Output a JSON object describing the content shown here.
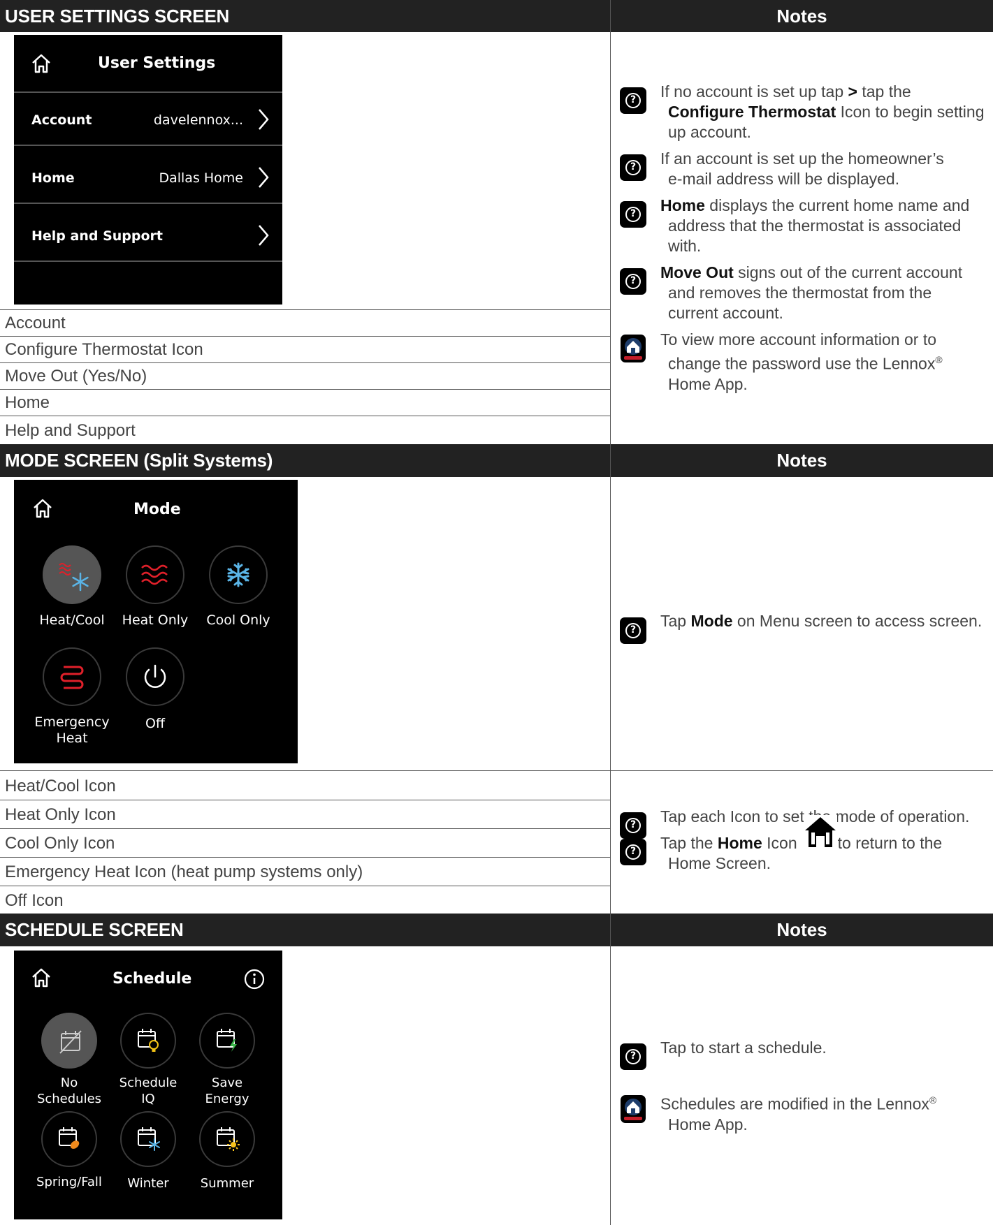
{
  "sections": {
    "user_settings": {
      "header": "USER SETTINGS SCREEN",
      "notes_header": "Notes",
      "screen": {
        "title": "User Settings",
        "rows": [
          {
            "label": "Account",
            "value": "davelennox..."
          },
          {
            "label": "Home",
            "value": "Dallas Home"
          },
          {
            "label": "Help and Support",
            "value": ""
          }
        ]
      },
      "list": [
        "Account",
        "Configure Thermostat Icon",
        "Move Out (Yes/No)",
        "Home",
        "Help and Support"
      ],
      "notes": {
        "n1_a": "If no account is set up tap ",
        "n1_b": ">",
        "n1_c": " tap the",
        "n1_d": "Configure Thermostat",
        "n1_e": " Icon to begin setting",
        "n1_f": "up account.",
        "n2_a": "If an account is set up the homeowner’s",
        "n2_b": "e-mail address will be displayed.",
        "n3_a": "Home",
        "n3_b": " displays the current home name and",
        "n3_c": "address that the thermostat is associated",
        "n3_d": "with.",
        "n4_a": "Move Out",
        "n4_b": " signs out of the current account",
        "n4_c": "and removes the thermostat from the",
        "n4_d": "current account.",
        "n5_a": "To view more account information or to",
        "n5_b": "change the password use the Lennox",
        "n5_reg": "®",
        "n5_c": "Home App."
      }
    },
    "mode": {
      "header": "MODE SCREEN (Split Systems)",
      "notes_header": "Notes",
      "screen": {
        "title": "Mode",
        "buttons": {
          "heat_cool": "Heat/Cool",
          "heat_only": "Heat Only",
          "cool_only": "Cool Only",
          "emergency_1": "Emergency",
          "emergency_2": "Heat",
          "off": "Off"
        }
      },
      "list": [
        "Heat/Cool Icon",
        "Heat Only Icon",
        "Cool Only Icon",
        "Emergency Heat Icon (heat pump systems only)",
        "Off Icon"
      ],
      "notes": {
        "n1_a": "Tap ",
        "n1_b": "Mode",
        "n1_c": " on Menu screen to access screen.",
        "n2": "Tap each Icon to set the mode of operation.",
        "n3_a": "Tap the ",
        "n3_b": "Home",
        "n3_c": " Icon",
        "n3_d": "to return to the",
        "n3_e": "Home Screen."
      }
    },
    "schedule": {
      "header": "SCHEDULE SCREEN",
      "notes_header": "Notes",
      "screen": {
        "title": "Schedule",
        "buttons": {
          "none_1": "No",
          "none_2": "Schedules",
          "iq_1": "Schedule",
          "iq_2": "IQ",
          "save_1": "Save",
          "save_2": "Energy",
          "spring": "Spring/Fall",
          "winter": "Winter",
          "summer": "Summer"
        }
      },
      "notes": {
        "n1": "Tap to start a schedule.",
        "n2_a": "Schedules are modified in the Lennox",
        "n2_reg": "®",
        "n2_b": "Home App."
      }
    }
  },
  "colors": {
    "header_bg": "#222222",
    "heat_red": "#e0202a",
    "cool_blue": "#5ab4e6",
    "energy_green": "#3bb54a",
    "spring_orange": "#f08a1c",
    "summer_yellow": "#f7c21a",
    "iq_yellow": "#f2c316"
  },
  "icons": [
    "home-icon",
    "chevron-right-icon",
    "help-icon",
    "lennox-app-icon",
    "info-icon",
    "snowflake-icon",
    "heat-waves-icon",
    "power-icon",
    "calendar-icon"
  ]
}
